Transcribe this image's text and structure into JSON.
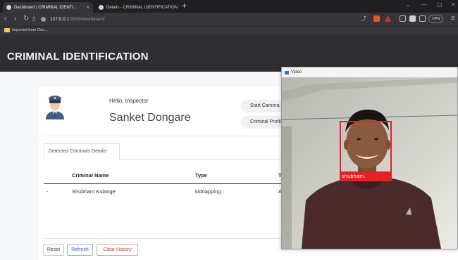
{
  "browser": {
    "tabs": [
      {
        "title": "Dashboard | CRIMINAL IDENTI..."
      },
      {
        "title": "Details - CRIMINAL IDENTIFICATION"
      }
    ],
    "url_host": "127.0.0.1",
    "url_path": ":8000/dashboard/",
    "vpn_label": "VPN",
    "bookmark": "Imported from Goo..."
  },
  "app": {
    "title": "CRIMINAL IDENTIFICATION"
  },
  "profile": {
    "greeting": "Hello, Inspector",
    "name": "Sanket Dongare"
  },
  "actions": {
    "start_camera": "Start Camera",
    "criminal_profiles": "Criminal Profiles"
  },
  "details": {
    "tab_label": "Detected Criminals Details",
    "columns": [
      "Criminal Name",
      "Type",
      "T"
    ],
    "rows": [
      {
        "bullet": "-",
        "name": "Shubham Kulange",
        "type": "kidnapping",
        "time": "A"
      }
    ]
  },
  "buttons": {
    "reset": "Reset",
    "refresh": "Refresh",
    "clear_history": "Clear History"
  },
  "video": {
    "window_title": "Video",
    "detected_label": "shubham."
  },
  "colors": {
    "detection": "#e32222",
    "app_header": "#2f2f33"
  }
}
